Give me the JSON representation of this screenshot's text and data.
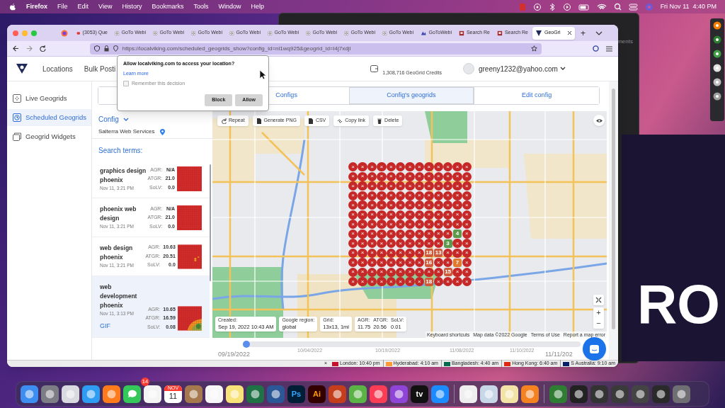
{
  "menubar": {
    "app": "Firefox",
    "menus": [
      "File",
      "Edit",
      "View",
      "History",
      "Bookmarks",
      "Tools",
      "Window",
      "Help"
    ],
    "clock": "Fri Nov 11  4:40 PM"
  },
  "background": {
    "window_text": "ments",
    "big_text": "RO"
  },
  "browser": {
    "tabs": [
      {
        "kind": "pinned",
        "selected": false
      },
      {
        "kind": "page",
        "label": "(3053) Que",
        "selected": false
      },
      {
        "kind": "page",
        "label": "GoTo Webi",
        "selected": false
      },
      {
        "kind": "page",
        "label": "GoTo Webi",
        "selected": false
      },
      {
        "kind": "page",
        "label": "GoTo Webi",
        "selected": false
      },
      {
        "kind": "page",
        "label": "GoTo Webi",
        "selected": false
      },
      {
        "kind": "page",
        "label": "GoTo Webi",
        "selected": false
      },
      {
        "kind": "page",
        "label": "GoTo Webi",
        "selected": false
      },
      {
        "kind": "page",
        "label": "GoTo Webi",
        "selected": false
      },
      {
        "kind": "page",
        "label": "GoTo Webi",
        "selected": false
      },
      {
        "kind": "page",
        "label": "GoToWebi",
        "selected": false
      },
      {
        "kind": "page",
        "label": "Search Re",
        "selected": false
      },
      {
        "kind": "page",
        "label": "Search Re",
        "selected": false
      },
      {
        "kind": "page",
        "label": "GeoGri",
        "selected": true
      }
    ],
    "new_tab": "+",
    "url": "https://localviking.com/scheduled_geogrids_show?config_id=nl1wq925&geogrid_id=l4j7xdjl"
  },
  "header": {
    "nav": [
      "Locations",
      "Bulk Posti"
    ],
    "credits": "1,308,716 GeoGrid Credits",
    "account": "greeny1232@yahoo.com"
  },
  "sidebar": {
    "items": [
      {
        "label": "Live Geogrids",
        "selected": false
      },
      {
        "label": "Scheduled Geogrids",
        "selected": true
      },
      {
        "label": "Geogrid Widgets",
        "selected": false
      }
    ]
  },
  "tabs": [
    {
      "selected": false
    },
    {
      "label": "Configs",
      "selected": false
    },
    {
      "label": "Config's geogrids",
      "selected": true
    },
    {
      "label": "Edit config",
      "selected": false
    }
  ],
  "config": {
    "title": "Config",
    "business": "Salterra Web Services"
  },
  "search_terms": {
    "title": "Search terms:",
    "items": [
      {
        "title": "graphics design phoenix",
        "date": "Nov 11, 3:21 PM",
        "selected": false,
        "stats": [
          {
            "label": "AGR:",
            "value": "N/A"
          },
          {
            "label": "ATGR:",
            "value": "21.0"
          },
          {
            "label": "SoLV:",
            "value": "0.0"
          }
        ]
      },
      {
        "title": "phoenix web design",
        "date": "Nov 11, 3:21 PM",
        "selected": false,
        "stats": [
          {
            "label": "AGR:",
            "value": "N/A"
          },
          {
            "label": "ATGR:",
            "value": "21.0"
          },
          {
            "label": "SoLV:",
            "value": "0.0"
          }
        ]
      },
      {
        "title": "web design phoenix",
        "date": "Nov 11, 3:21 PM",
        "selected": false,
        "stats": [
          {
            "label": "AGR:",
            "value": "10.63"
          },
          {
            "label": "ATGR:",
            "value": "20.51"
          },
          {
            "label": "SoLV:",
            "value": "0.0"
          }
        ]
      },
      {
        "title": "web development phoenix",
        "date": "Nov 11, 3:13 PM",
        "selected": true,
        "link": "GIF",
        "stats": [
          {
            "label": "AGR:",
            "value": "10.65"
          },
          {
            "label": "ATGR:",
            "value": "16.59"
          },
          {
            "label": "SoLV:",
            "value": "0.08"
          }
        ]
      }
    ]
  },
  "map": {
    "actions": [
      "Repeat",
      "Generate PNG",
      "CSV",
      "Copy link",
      "Delete"
    ],
    "info": [
      {
        "label": "Created:",
        "value": "Sep 19, 2022 10:43 AM"
      },
      {
        "label": "Google region:",
        "value": "global"
      },
      {
        "label": "Grid:",
        "value": "13x13, 1mi"
      }
    ],
    "metrics": [
      {
        "label": "AGR:",
        "value": "11.75"
      },
      {
        "label": "ATGR:",
        "value": "20.56"
      },
      {
        "label": "SoLV:",
        "value": "0.01"
      }
    ],
    "grid": [
      [
        "×",
        "×",
        "×",
        "×",
        "×",
        "×",
        "×",
        "×",
        "×",
        "×",
        "×",
        "×",
        "×"
      ],
      [
        "×",
        "×",
        "×",
        "×",
        "×",
        "×",
        "×",
        "×",
        "×",
        "×",
        "×",
        "×",
        "×"
      ],
      [
        "×",
        "×",
        "×",
        "×",
        "×",
        "×",
        "×",
        "×",
        "×",
        "×",
        "×",
        "×",
        "×"
      ],
      [
        "×",
        "×",
        "×",
        "×",
        "×",
        "×",
        "×",
        "×",
        "×",
        "×",
        "×",
        "×",
        "×"
      ],
      [
        "×",
        "×",
        "×",
        "×",
        "×",
        "×",
        "×",
        "×",
        "×",
        "×",
        "×",
        "×",
        "×"
      ],
      [
        "×",
        "×",
        "×",
        "×",
        "×",
        "×",
        "×",
        "×",
        "×",
        "×",
        "×",
        "×",
        "×"
      ],
      [
        "×",
        "×",
        "×",
        "×",
        "×",
        "×",
        "×",
        "×",
        "×",
        "×",
        "×",
        "×",
        "×"
      ],
      [
        "×",
        "×",
        "×",
        "×",
        "×",
        "×",
        "×",
        "×",
        "×",
        "×",
        "×",
        "4",
        "×"
      ],
      [
        "×",
        "×",
        "×",
        "×",
        "×",
        "×",
        "×",
        "×",
        "×",
        "×",
        "3",
        "×",
        "×"
      ],
      [
        "×",
        "×",
        "×",
        "×",
        "×",
        "×",
        "×",
        "×",
        "18",
        "13",
        "×",
        "×",
        "×"
      ],
      [
        "×",
        "×",
        "×",
        "×",
        "×",
        "×",
        "×",
        "×",
        "16",
        "×",
        "×",
        "7",
        "×"
      ],
      [
        "×",
        "×",
        "×",
        "×",
        "×",
        "×",
        "×",
        "×",
        "×",
        "×",
        "15",
        "×",
        "×"
      ],
      [
        "×",
        "×",
        "×",
        "×",
        "×",
        "×",
        "×",
        "×",
        "18",
        "×",
        "×",
        "×",
        "×"
      ]
    ],
    "zoom": [
      "+",
      "−"
    ],
    "attribution": [
      "Keyboard shortcuts",
      "Map data ©2022 Google",
      "Terms of Use",
      "Report a map error"
    ]
  },
  "timeline": {
    "level": 0,
    "start": "09/19/2022",
    "ticks": [
      "10/04/2022",
      "10/19/2022",
      "11/08/2022",
      "11/10/2022"
    ],
    "end": "11/11/202"
  },
  "popup": {
    "question": "Allow localviking.com to access your location?",
    "link": "Learn more",
    "remember": "Remember this decision",
    "checked": false,
    "buttons": [
      "Block",
      "Allow"
    ]
  },
  "status_bar": {
    "close": "×",
    "clocks": [
      "London: 10:40 pm",
      "Hyderabad: 4:10 am",
      "Bangladesh: 4:40 am",
      "Hong Kong: 6:40 am",
      "S Australia: 9:10 am"
    ]
  },
  "dock": [
    {
      "kind": "icon"
    },
    {
      "kind": "icon"
    },
    {
      "kind": "icon"
    },
    {
      "kind": "icon"
    },
    {
      "kind": "icon"
    },
    {
      "kind": "badge",
      "badge": "14"
    },
    {
      "kind": "icon"
    },
    {
      "kind": "calendar",
      "month": "NOV",
      "day": "11"
    },
    {
      "kind": "icon"
    },
    {
      "kind": "icon"
    },
    {
      "kind": "icon"
    },
    {
      "kind": "icon"
    },
    {
      "kind": "icon"
    },
    {
      "kind": "letters",
      "text": "Ps"
    },
    {
      "kind": "letters",
      "text": "Ai"
    },
    {
      "kind": "icon"
    },
    {
      "kind": "icon"
    },
    {
      "kind": "icon"
    },
    {
      "kind": "icon"
    },
    {
      "kind": "letters",
      "text": "tv"
    },
    {
      "kind": "icon"
    },
    {
      "kind": "divider"
    },
    {
      "kind": "icon"
    },
    {
      "kind": "icon"
    },
    {
      "kind": "icon"
    },
    {
      "kind": "icon"
    },
    {
      "kind": "divider"
    },
    {
      "kind": "icon"
    },
    {
      "kind": "icon"
    },
    {
      "kind": "icon"
    },
    {
      "kind": "icon"
    },
    {
      "kind": "icon"
    },
    {
      "kind": "icon"
    },
    {
      "kind": "icon"
    }
  ]
}
